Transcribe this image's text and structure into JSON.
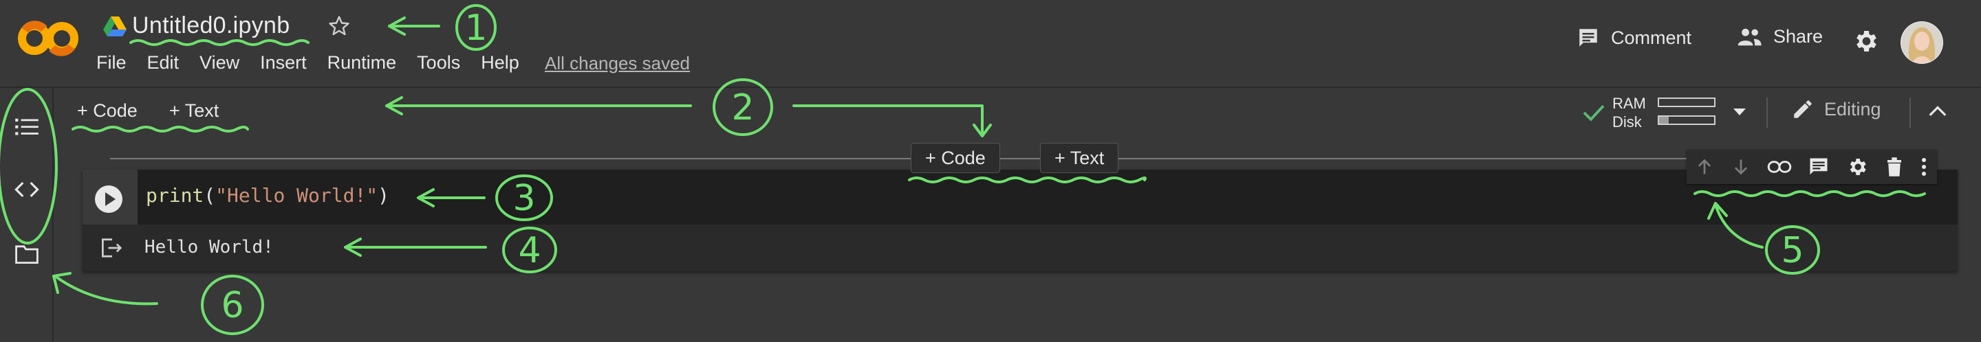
{
  "header": {
    "filename": "Untitled0.ipynb",
    "menu": [
      "File",
      "Edit",
      "View",
      "Insert",
      "Runtime",
      "Tools",
      "Help"
    ],
    "saved_status": "All changes saved",
    "comment_label": "Comment",
    "share_label": "Share",
    "logo_icon": "colab-logo",
    "drive_icon": "google-drive-icon",
    "star_icon": "star-outline-icon"
  },
  "toolbar": {
    "add_code_label": "+ Code",
    "add_text_label": "+ Text",
    "ram_label": "RAM",
    "disk_label": "Disk",
    "ram_usage": 0.0,
    "disk_usage": 0.18,
    "editing_label": "Editing"
  },
  "insert_bar": {
    "code_label": "+ Code",
    "text_label": "+ Text"
  },
  "cell": {
    "code": {
      "fn": "print",
      "open": "(",
      "str": "\"Hello World!\"",
      "close": ")"
    },
    "output": "Hello World!"
  },
  "cell_toolbar_icons": [
    "arrow-up-icon",
    "arrow-down-icon",
    "link-icon",
    "comment-icon",
    "gear-icon",
    "trash-icon",
    "more-vert-icon"
  ],
  "annotations": [
    "1",
    "2",
    "3",
    "4",
    "5",
    "6"
  ],
  "colors": {
    "background": "#383838",
    "cell_bg": "#1f1f1f",
    "accent_orange": "#f9ab00",
    "annotation_green": "#6fe06f",
    "connected_check": "#5bb974"
  }
}
